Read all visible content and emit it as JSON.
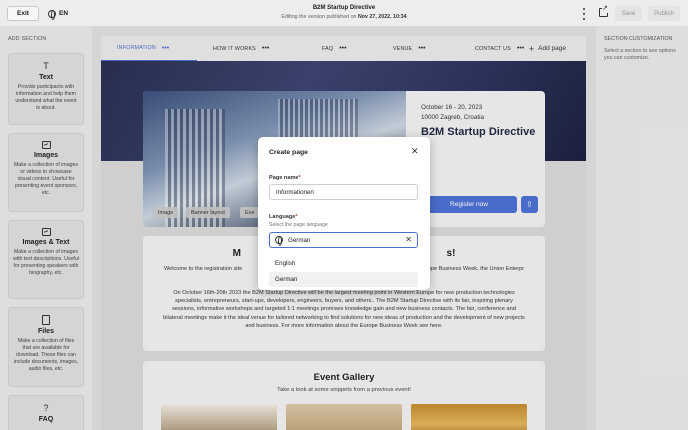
{
  "topbar": {
    "exit_label": "Exit",
    "language": "EN",
    "title": "B2M Startup Directive",
    "subtitle_prefix": "Editing the version published on",
    "subtitle_date": "Nov 27, 2022, 10:34",
    "save_label": "Save",
    "publish_label": "Publish"
  },
  "left_sidebar": {
    "title": "ADD SECTION",
    "sections": [
      {
        "name": "Text",
        "icon": "text-icon",
        "description": "Provide participants with information and help them understand what the event is about."
      },
      {
        "name": "Images",
        "icon": "image-icon",
        "description": "Make a collection of images or videos to showcase visual content. Useful for presenting event sponsors, etc."
      },
      {
        "name": "Images & Text",
        "icon": "image-text-icon",
        "description": "Make a collection of images with text descriptions. Useful for presenting speakers with biography, etc."
      },
      {
        "name": "Files",
        "icon": "file-icon",
        "description": "Make a collection of files that are available for download. These files can include documents, images, audio files, etc."
      },
      {
        "name": "FAQ",
        "icon": "question-icon",
        "description": ""
      }
    ]
  },
  "right_sidebar": {
    "title": "SECTION CUSTOMIZATION",
    "description": "Select a section to see options you can customize."
  },
  "page_tabs": [
    {
      "label": "INFORMATION",
      "active": true
    },
    {
      "label": "HOW IT WORKS",
      "active": false
    },
    {
      "label": "FAQ",
      "active": false
    },
    {
      "label": "VENUE",
      "active": false
    },
    {
      "label": "CONTACT US",
      "active": false
    }
  ],
  "add_page_label": "Add page",
  "hero": {
    "date": "October 16 - 20, 2023",
    "location": "10000 Zagreb, Croatia",
    "event_name": "B2M Startup Directive",
    "register_label": "Register now",
    "image_chips": [
      "Image",
      "Banner layout",
      "Eve"
    ]
  },
  "welcome": {
    "title": "M                                                                          s!",
    "paragraph1": "Welcome to the registration site                                                                              s, the organizer of the Europe Business Week, the Union Enterpr                                                                     uring the Europe Business Week.",
    "paragraph2": "On October 16th-20th 2023 the B2M Startup Directive will be the largest meeting point in Western Europe for new production technologies specialists, entrepreneurs, start-ups, developers, engineers, buyers, and others.. The B2M Startup Directive with its fair, inspiring plenary sessions, informative workshops and targeted 1:1 meetings promises knowledge gain and new business contacts. The fair, conference and bilateral meetings make it the ideal venue for tailored networking to find solutions for new ideas of production and the development of new projects and business. For more information about the Europe Business Week see here."
  },
  "gallery": {
    "title": "Event Gallery",
    "subtitle": "Take a look at some snippets from a previous event!"
  },
  "modal": {
    "title": "Create page",
    "page_name_label": "Page name",
    "page_name_value": "Informationen",
    "language_label": "Language",
    "language_hint": "Select the page language",
    "language_value": "German",
    "options": [
      "English",
      "German"
    ],
    "selected_option": "German"
  },
  "colors": {
    "accent": "#4c6fd1",
    "required": "#d0312d"
  }
}
